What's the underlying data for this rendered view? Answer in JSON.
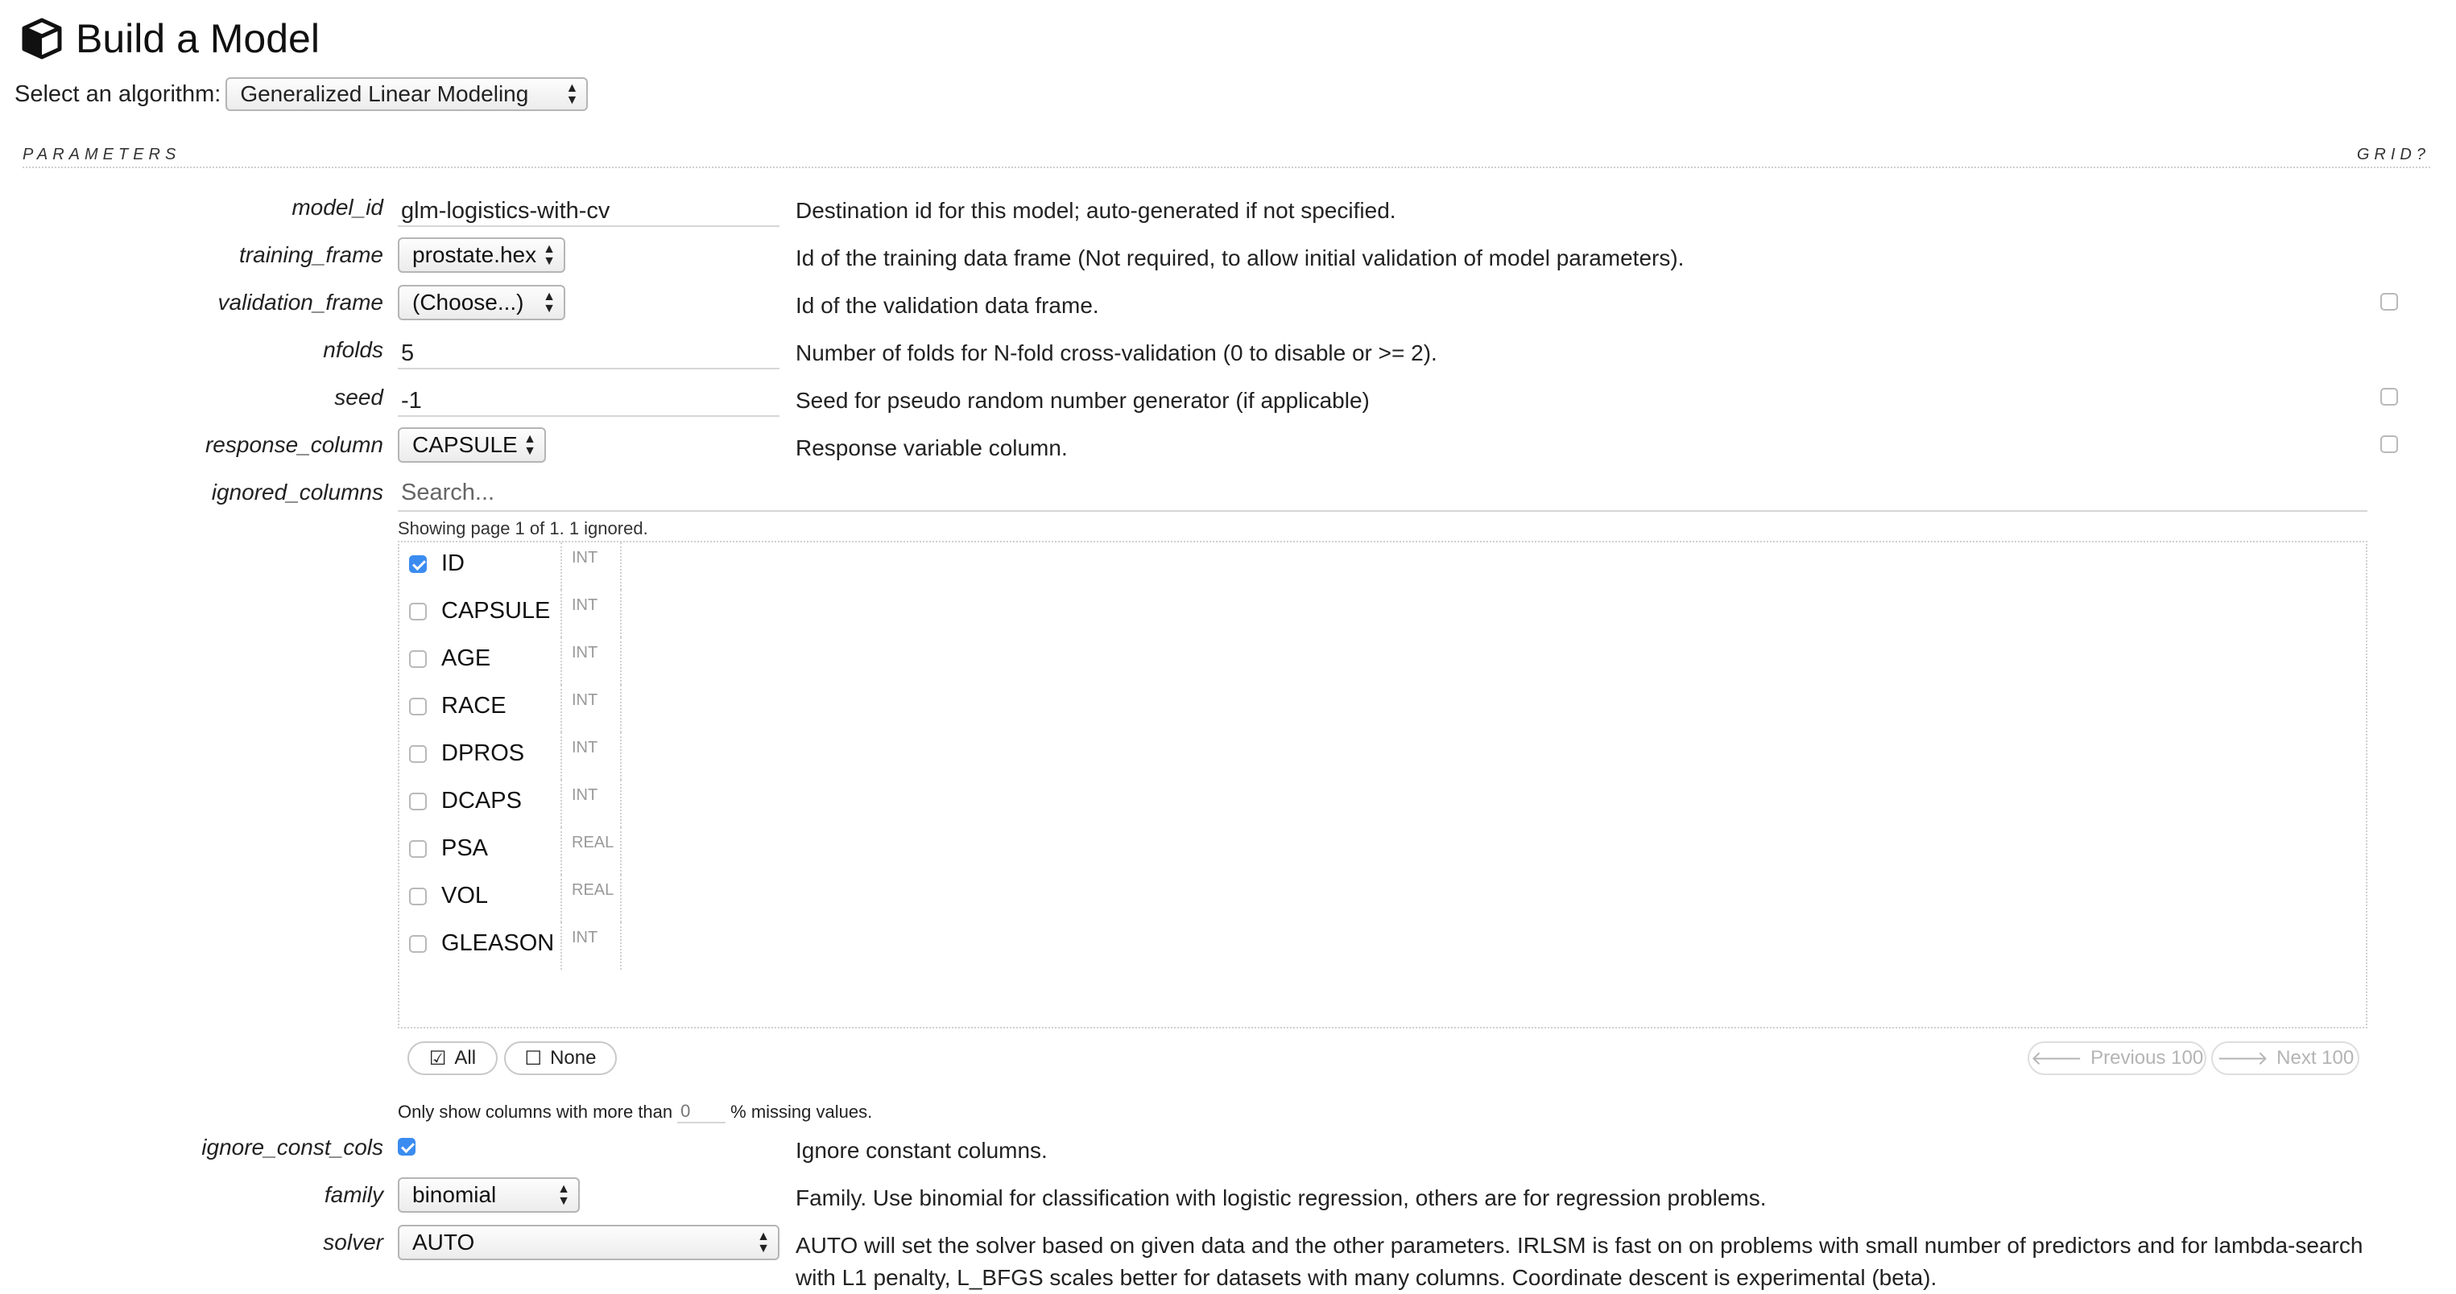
{
  "header": {
    "title": "Build a Model",
    "title_icon": "cube-icon",
    "algorithm_label": "Select an algorithm:",
    "algorithm_value": "Generalized Linear Modeling"
  },
  "section": {
    "title": "PARAMETERS",
    "grid_label": "GRID?"
  },
  "params": {
    "model_id": {
      "label": "model_id",
      "value": "glm-logistics-with-cv",
      "desc": "Destination id for this model; auto-generated if not specified."
    },
    "training_frame": {
      "label": "training_frame",
      "value": "prostate.hex",
      "desc": "Id of the training data frame (Not required, to allow initial validation of model parameters)."
    },
    "validation_frame": {
      "label": "validation_frame",
      "value": "(Choose...)",
      "desc": "Id of the validation data frame."
    },
    "nfolds": {
      "label": "nfolds",
      "value": "5",
      "desc": "Number of folds for N-fold cross-validation (0 to disable or >= 2)."
    },
    "seed": {
      "label": "seed",
      "value": "-1",
      "desc": "Seed for pseudo random number generator (if applicable)"
    },
    "response_column": {
      "label": "response_column",
      "value": "CAPSULE",
      "desc": "Response variable column."
    },
    "ignored_columns": {
      "label": "ignored_columns",
      "search_placeholder": "Search...",
      "page_info": "Showing page 1 of 1. 1 ignored.",
      "columns": [
        {
          "name": "ID",
          "type": "INT",
          "checked": true
        },
        {
          "name": "CAPSULE",
          "type": "INT",
          "checked": false
        },
        {
          "name": "AGE",
          "type": "INT",
          "checked": false
        },
        {
          "name": "RACE",
          "type": "INT",
          "checked": false
        },
        {
          "name": "DPROS",
          "type": "INT",
          "checked": false
        },
        {
          "name": "DCAPS",
          "type": "INT",
          "checked": false
        },
        {
          "name": "PSA",
          "type": "REAL",
          "checked": false
        },
        {
          "name": "VOL",
          "type": "REAL",
          "checked": false
        },
        {
          "name": "GLEASON",
          "type": "INT",
          "checked": false
        }
      ],
      "all_label": "All",
      "none_label": "None",
      "prev_label": "Previous 100",
      "next_label": "Next 100",
      "missing_prefix": "Only show columns with more than",
      "missing_value": "0",
      "missing_suffix": "% missing values."
    },
    "ignore_const_cols": {
      "label": "ignore_const_cols",
      "checked": true,
      "desc": "Ignore constant columns."
    },
    "family": {
      "label": "family",
      "value": "binomial",
      "desc": "Family. Use binomial for classification with logistic regression, others are for regression problems."
    },
    "solver": {
      "label": "solver",
      "value": "AUTO",
      "desc_line1": "AUTO will set the solver based on given data and the other parameters. IRLSM is fast on on problems with small number of predictors and for lambda-search",
      "desc_line2": "with L1 penalty, L_BFGS scales better for datasets with many columns. Coordinate descent is experimental (beta)."
    }
  },
  "colors": {
    "accent": "#3b8cf0",
    "border": "#b5b5b5",
    "muted": "#999999"
  }
}
